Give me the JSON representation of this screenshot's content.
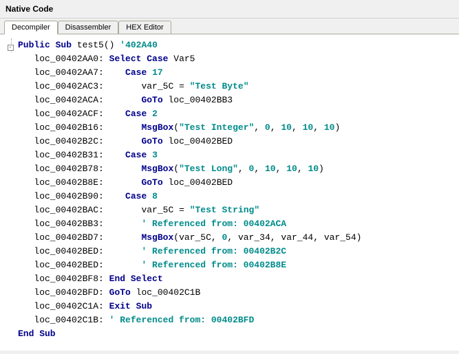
{
  "panel": {
    "title": "Native Code"
  },
  "tabs": [
    {
      "label": "Decompiler",
      "active": true
    },
    {
      "label": "Disassembler",
      "active": false
    },
    {
      "label": "HEX Editor",
      "active": false
    }
  ],
  "code": {
    "declaration": {
      "kw1": "Public",
      "kw2": "Sub",
      "name": "test5",
      "parens": "()",
      "comment": "'402A40"
    },
    "lines": [
      {
        "label": "loc_00402AA0:",
        "indent": 1,
        "tokens": [
          {
            "t": "kw",
            "v": "Select Case"
          },
          {
            "t": "sp"
          },
          {
            "t": "ident",
            "v": "Var5"
          }
        ]
      },
      {
        "label": "loc_00402AA7:",
        "indent": 2,
        "tokens": [
          {
            "t": "kw",
            "v": "Case"
          },
          {
            "t": "sp"
          },
          {
            "t": "num",
            "v": "17"
          }
        ]
      },
      {
        "label": "loc_00402AC3:",
        "indent": 3,
        "tokens": [
          {
            "t": "ident",
            "v": "var_5C"
          },
          {
            "t": "sp"
          },
          {
            "t": "punct",
            "v": "="
          },
          {
            "t": "sp"
          },
          {
            "t": "string",
            "v": "\"Test Byte\""
          }
        ]
      },
      {
        "label": "loc_00402ACA:",
        "indent": 3,
        "tokens": [
          {
            "t": "kw",
            "v": "GoTo"
          },
          {
            "t": "sp"
          },
          {
            "t": "ident",
            "v": "loc_00402BB3"
          }
        ]
      },
      {
        "label": "loc_00402ACF:",
        "indent": 2,
        "tokens": [
          {
            "t": "kw",
            "v": "Case"
          },
          {
            "t": "sp"
          },
          {
            "t": "num",
            "v": "2"
          }
        ]
      },
      {
        "label": "loc_00402B16:",
        "indent": 3,
        "tokens": [
          {
            "t": "func",
            "v": "MsgBox"
          },
          {
            "t": "punct",
            "v": "("
          },
          {
            "t": "string",
            "v": "\"Test Integer\""
          },
          {
            "t": "punct",
            "v": ","
          },
          {
            "t": "sp"
          },
          {
            "t": "num",
            "v": "0"
          },
          {
            "t": "punct",
            "v": ","
          },
          {
            "t": "sp"
          },
          {
            "t": "num",
            "v": "10"
          },
          {
            "t": "punct",
            "v": ","
          },
          {
            "t": "sp"
          },
          {
            "t": "num",
            "v": "10"
          },
          {
            "t": "punct",
            "v": ","
          },
          {
            "t": "sp"
          },
          {
            "t": "num",
            "v": "10"
          },
          {
            "t": "punct",
            "v": ")"
          }
        ]
      },
      {
        "label": "loc_00402B2C:",
        "indent": 3,
        "tokens": [
          {
            "t": "kw",
            "v": "GoTo"
          },
          {
            "t": "sp"
          },
          {
            "t": "ident",
            "v": "loc_00402BED"
          }
        ]
      },
      {
        "label": "loc_00402B31:",
        "indent": 2,
        "tokens": [
          {
            "t": "kw",
            "v": "Case"
          },
          {
            "t": "sp"
          },
          {
            "t": "num",
            "v": "3"
          }
        ]
      },
      {
        "label": "loc_00402B78:",
        "indent": 3,
        "tokens": [
          {
            "t": "func",
            "v": "MsgBox"
          },
          {
            "t": "punct",
            "v": "("
          },
          {
            "t": "string",
            "v": "\"Test Long\""
          },
          {
            "t": "punct",
            "v": ","
          },
          {
            "t": "sp"
          },
          {
            "t": "num",
            "v": "0"
          },
          {
            "t": "punct",
            "v": ","
          },
          {
            "t": "sp"
          },
          {
            "t": "num",
            "v": "10"
          },
          {
            "t": "punct",
            "v": ","
          },
          {
            "t": "sp"
          },
          {
            "t": "num",
            "v": "10"
          },
          {
            "t": "punct",
            "v": ","
          },
          {
            "t": "sp"
          },
          {
            "t": "num",
            "v": "10"
          },
          {
            "t": "punct",
            "v": ")"
          }
        ]
      },
      {
        "label": "loc_00402B8E:",
        "indent": 3,
        "tokens": [
          {
            "t": "kw",
            "v": "GoTo"
          },
          {
            "t": "sp"
          },
          {
            "t": "ident",
            "v": "loc_00402BED"
          }
        ]
      },
      {
        "label": "loc_00402B90:",
        "indent": 2,
        "tokens": [
          {
            "t": "kw",
            "v": "Case"
          },
          {
            "t": "sp"
          },
          {
            "t": "num",
            "v": "8"
          }
        ]
      },
      {
        "label": "loc_00402BAC:",
        "indent": 3,
        "tokens": [
          {
            "t": "ident",
            "v": "var_5C"
          },
          {
            "t": "sp"
          },
          {
            "t": "punct",
            "v": "="
          },
          {
            "t": "sp"
          },
          {
            "t": "string",
            "v": "\"Test String\""
          }
        ]
      },
      {
        "label": "loc_00402BB3:",
        "indent": 3,
        "tokens": [
          {
            "t": "comment",
            "v": "' Referenced from: 00402ACA"
          }
        ]
      },
      {
        "label": "loc_00402BD7:",
        "indent": 3,
        "tokens": [
          {
            "t": "func",
            "v": "MsgBox"
          },
          {
            "t": "punct",
            "v": "("
          },
          {
            "t": "ident",
            "v": "var_5C"
          },
          {
            "t": "punct",
            "v": ","
          },
          {
            "t": "sp"
          },
          {
            "t": "num",
            "v": "0"
          },
          {
            "t": "punct",
            "v": ","
          },
          {
            "t": "sp"
          },
          {
            "t": "ident",
            "v": "var_34"
          },
          {
            "t": "punct",
            "v": ","
          },
          {
            "t": "sp"
          },
          {
            "t": "ident",
            "v": "var_44"
          },
          {
            "t": "punct",
            "v": ","
          },
          {
            "t": "sp"
          },
          {
            "t": "ident",
            "v": "var_54"
          },
          {
            "t": "punct",
            "v": ")"
          }
        ]
      },
      {
        "label": "loc_00402BED:",
        "indent": 3,
        "tokens": [
          {
            "t": "comment",
            "v": "' Referenced from: 00402B2C"
          }
        ]
      },
      {
        "label": "loc_00402BED:",
        "indent": 3,
        "tokens": [
          {
            "t": "comment",
            "v": "' Referenced from: 00402B8E"
          }
        ]
      },
      {
        "label": "loc_00402BF8:",
        "indent": 1,
        "tokens": [
          {
            "t": "kw",
            "v": "End Select"
          }
        ]
      },
      {
        "label": "loc_00402BFD:",
        "indent": 1,
        "tokens": [
          {
            "t": "kw",
            "v": "GoTo"
          },
          {
            "t": "sp"
          },
          {
            "t": "ident",
            "v": "loc_00402C1B"
          }
        ]
      },
      {
        "label": "loc_00402C1A:",
        "indent": 1,
        "tokens": [
          {
            "t": "kw",
            "v": "Exit Sub"
          }
        ]
      },
      {
        "label": "loc_00402C1B:",
        "indent": 1,
        "tokens": [
          {
            "t": "comment",
            "v": "' Referenced from: 00402BFD"
          }
        ]
      }
    ],
    "end": {
      "kw": "End Sub"
    }
  }
}
